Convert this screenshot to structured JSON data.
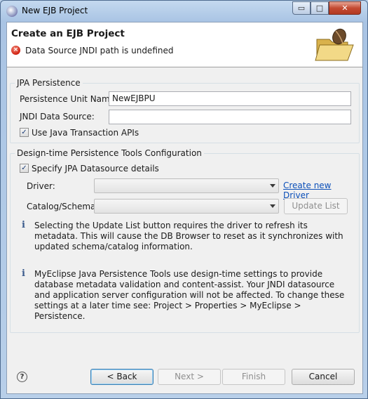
{
  "window": {
    "title": "New EJB Project",
    "controls": {
      "minimize": "▭",
      "maximize": "□",
      "close": "✕"
    }
  },
  "banner": {
    "title": "Create an EJB Project",
    "error_message": "Data Source JNDI path is undefined",
    "error_icon": "×"
  },
  "jpa": {
    "group_label": "JPA Persistence",
    "unit_name_label": "Persistence Unit Name:",
    "unit_name_value": "NewEJBPU",
    "jndi_label": "JNDI Data Source:",
    "jndi_value": "",
    "jta_label": "Use Java Transaction APIs",
    "jta_checked": true
  },
  "tools": {
    "group_label": "Design-time Persistence Tools Configuration",
    "specify_label": "Specify JPA Datasource details",
    "specify_checked": true,
    "driver_label": "Driver:",
    "driver_value": "",
    "create_driver_link": "Create new Driver",
    "catalog_label": "Catalog/Schema:",
    "catalog_value": "",
    "update_list_button": "Update List",
    "info1": "Selecting the Update List button requires the driver to refresh its metadata. This will cause the DB Browser to reset as it synchronizes with updated schema/catalog information.",
    "info2": "MyEclipse Java Persistence Tools use design-time settings to provide database metadata validation and content-assist. Your JNDI datasource and application server configuration will not be affected. To change these settings at a later time see: Project > Properties > MyEclipse > Persistence."
  },
  "footer": {
    "back": "< Back",
    "next": "Next >",
    "finish": "Finish",
    "cancel": "Cancel"
  }
}
